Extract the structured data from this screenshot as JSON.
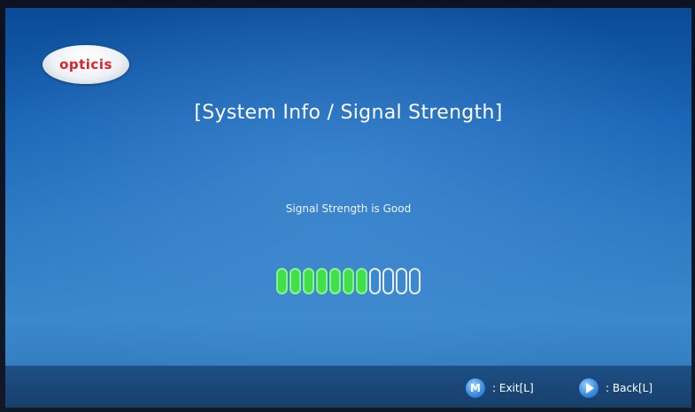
{
  "brand": {
    "logo_text": "opticis"
  },
  "screen": {
    "title": "[System Info / Signal Strength]",
    "status_text": "Signal Strength is Good"
  },
  "signal_meter": {
    "total_bars": 11,
    "lit_bars": 7,
    "lit_color": "#3fe04a",
    "unlit_color": "#e8eef8"
  },
  "footer": {
    "exit": {
      "icon": "m-button-icon",
      "key_label": "M",
      "label": ": Exit[L]"
    },
    "back": {
      "icon": "play-button-icon",
      "label": ": Back[L]"
    }
  }
}
